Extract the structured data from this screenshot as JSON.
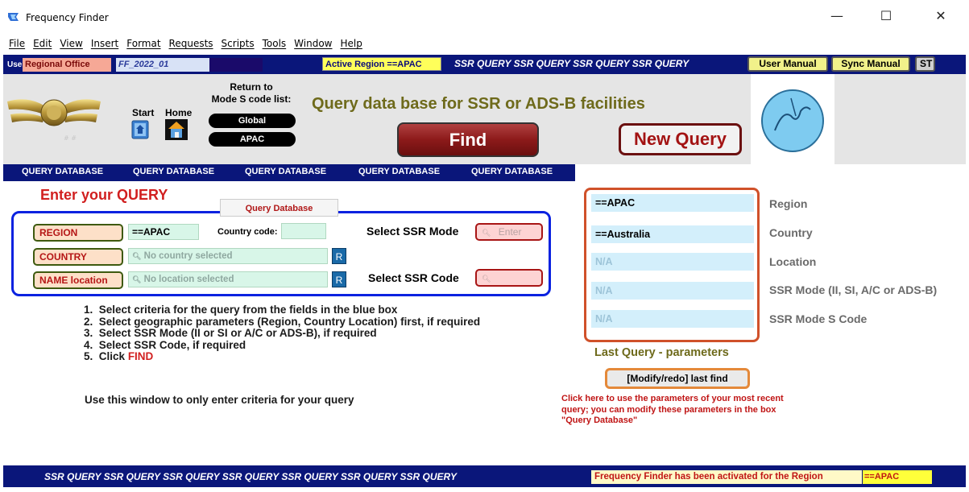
{
  "window": {
    "title": "Frequency Finder",
    "controls": {
      "minimize": "—",
      "maximize": "☐",
      "close": "✕"
    }
  },
  "menu": [
    "File",
    "Edit",
    "View",
    "Insert",
    "Format",
    "Requests",
    "Scripts",
    "Tools",
    "Window",
    "Help"
  ],
  "header": {
    "user_label": "User",
    "user_value": "Regional Office",
    "version": "FF_2022_01",
    "active_region_label": "Active Region ==APAC",
    "banner": "SSR QUERY SSR QUERY SSR QUERY SSR QUERY",
    "user_manual": "User Manual",
    "sync_manual": "Sync Manual",
    "st_button": "ST"
  },
  "top": {
    "logo_caption": "# #",
    "start_label": "Start",
    "home_label": "Home",
    "return_to_label": "Return to Mode S code list:",
    "return_to_line1": "Return to",
    "return_to_line2": "Mode S code list:",
    "global_button": "Global",
    "apac_button": "APAC",
    "headline": "Query data base for SSR or ADS-B facilities",
    "find_button": "Find",
    "new_query_button": "New Query"
  },
  "tabs": [
    "QUERY DATABASE",
    "QUERY DATABASE",
    "QUERY DATABASE",
    "QUERY DATABASE",
    "QUERY DATABASE"
  ],
  "query": {
    "title": "Enter your QUERY",
    "box_title": "Query Database",
    "region_button": "REGION",
    "region_value": "==APAC",
    "country_code_label": "Country code:",
    "country_code_value": "",
    "country_button": "COUNTRY",
    "country_placeholder": "No country selected",
    "name_location_button": "NAME location",
    "location_placeholder": "No location selected",
    "r_button": "R",
    "select_ssr_mode_label": "Select SSR Mode",
    "ssr_mode_placeholder": "Enter",
    "select_ssr_code_label": "Select SSR Code",
    "ssr_code_placeholder": ""
  },
  "instructions": [
    {
      "num": "1.",
      "text": "Select criteria for the query from the fields in the blue box"
    },
    {
      "num": "2.",
      "text": "Select geographic parameters (Region, Country Location) first, if required"
    },
    {
      "num": "3.",
      "text": "Select SSR Mode (II or SI or A/C or ADS-B), if required"
    },
    {
      "num": "4.",
      "text": "Select SSR Code, if required"
    },
    {
      "num": "5.",
      "text": "Click ",
      "emph": "FIND"
    }
  ],
  "note": "Use this window to only enter criteria for your query",
  "last_query": {
    "fields": [
      {
        "value": "==APAC",
        "label": "Region"
      },
      {
        "value": "==Australia",
        "label": "Country"
      },
      {
        "value": "N/A",
        "label": "Location"
      },
      {
        "value": "N/A",
        "label": "SSR Mode (II, SI, A/C or ADS-B)"
      },
      {
        "value": "N/A",
        "label": "SSR Mode S Code"
      }
    ],
    "caption": "Last Query - parameters",
    "modify_button": "[Modify/redo] last find",
    "modify_note": "Click here to use the parameters of your most recent query; you can modify these parameters in the box \"Query Database\""
  },
  "footer": {
    "banner": "SSR QUERY SSR QUERY SSR QUERY SSR QUERY SSR QUERY SSR QUERY SSR QUERY",
    "activated_msg": "Frequency Finder has been activated for the Region",
    "region": "==APAC"
  },
  "colors": {
    "navy": "#0a167a",
    "query_red": "#d11f1f",
    "olive": "#6e6a1b",
    "box_blue": "#0a22e0",
    "last_query_border": "#d0512a"
  }
}
